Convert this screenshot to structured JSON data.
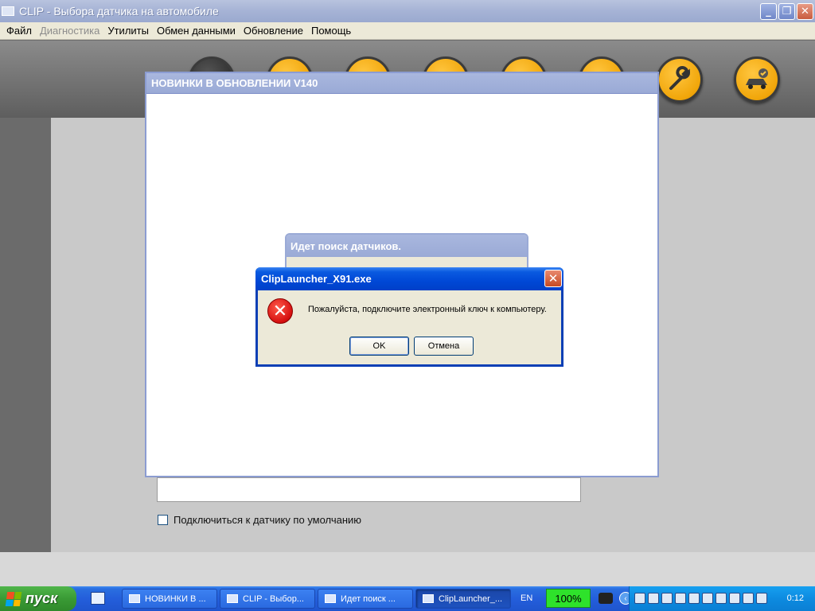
{
  "app": {
    "title": "CLIP - Выбора датчика на автомобиле"
  },
  "menu": {
    "items": [
      {
        "label": "Файл",
        "disabled": false
      },
      {
        "label": "Диагностика",
        "disabled": true
      },
      {
        "label": "Утилиты",
        "disabled": false
      },
      {
        "label": "Обмен данными",
        "disabled": false
      },
      {
        "label": "Обновление",
        "disabled": false
      },
      {
        "label": "Помощь",
        "disabled": false
      }
    ]
  },
  "toolbar": {
    "icons": [
      "diagnostics-icon",
      "ecu-icon",
      "search-icon",
      "data-icon",
      "update-icon",
      "tools-icon",
      "wrench-icon",
      "car-check-icon"
    ]
  },
  "updates_window": {
    "title": "НОВИНКИ В ОБНОВЛЕНИИ V140"
  },
  "search_dialog": {
    "title": "Идет поиск датчиков."
  },
  "error_dialog": {
    "title": "ClipLauncher_X91.exe",
    "message": "Пожалуйста, подключите электронный ключ к компьютеру.",
    "ok_label": "OK",
    "cancel_label": "Отмена"
  },
  "page": {
    "default_sensor_label": "Подключиться к датчику по умолчанию"
  },
  "taskbar": {
    "start_label": "пуск",
    "tasks": [
      {
        "label": "НОВИНКИ В ..."
      },
      {
        "label": "CLIP - Выбор..."
      },
      {
        "label": "Идет поиск ..."
      },
      {
        "label": "ClipLauncher_..."
      }
    ],
    "language": "EN",
    "battery": "100%",
    "clock": "0:12"
  }
}
